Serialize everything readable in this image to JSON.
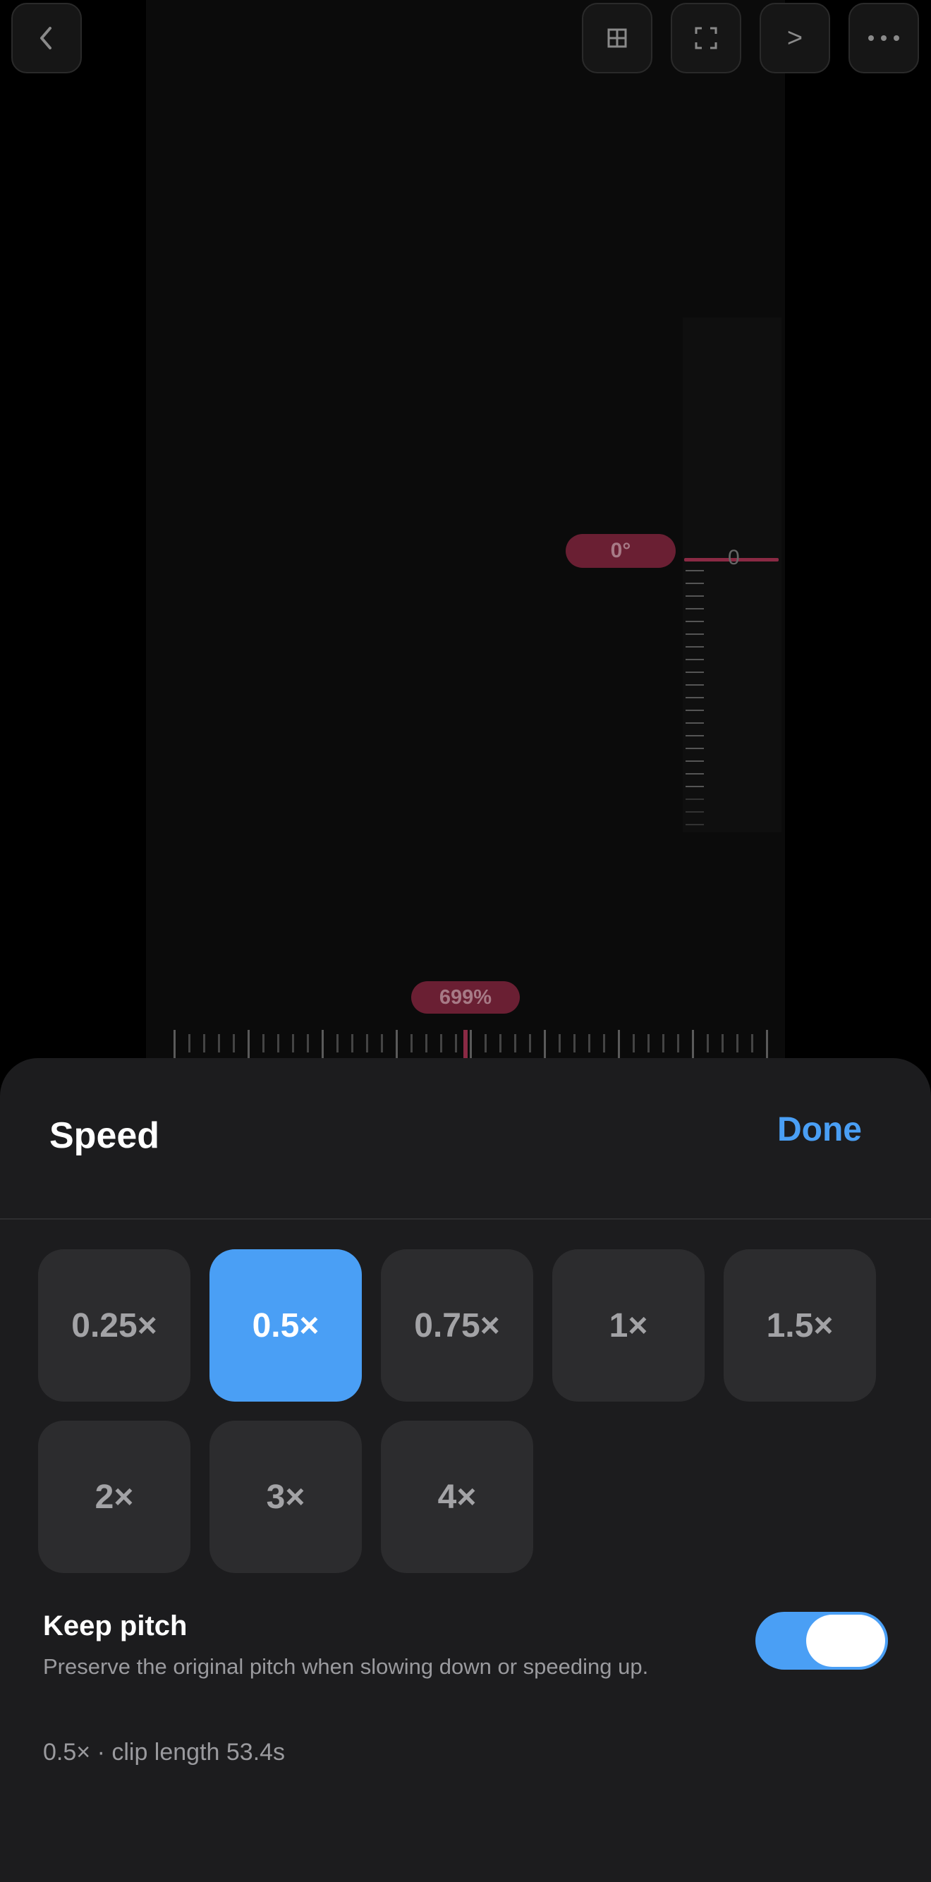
{
  "toolbar": {
    "back_icon": "chevron-left-icon",
    "grid_icon": "grid-icon",
    "fullscreen_icon": "fullscreen-icon",
    "next_label": ">",
    "more_icon": "ellipsis-icon"
  },
  "canvas": {
    "rotation_label": "0°",
    "vertical_ruler_zero": "0",
    "zoom_label": "699%"
  },
  "sheet": {
    "title": "Speed",
    "done_label": "Done",
    "speed_options": [
      "0.25×",
      "0.5×",
      "0.75×",
      "1×",
      "1.5×",
      "2×",
      "3×",
      "4×"
    ],
    "selected_speed": "0.5×",
    "keep_pitch": {
      "title": "Keep pitch",
      "description": "Preserve the original pitch when slowing down or speeding up.",
      "enabled": true
    },
    "status_line": "0.5× · clip length 53.4s"
  },
  "colors": {
    "accent": "#4a9ff5",
    "sheet_bg": "#1c1c1e",
    "button_bg": "#2c2c2e",
    "marker": "#8a2a44"
  }
}
